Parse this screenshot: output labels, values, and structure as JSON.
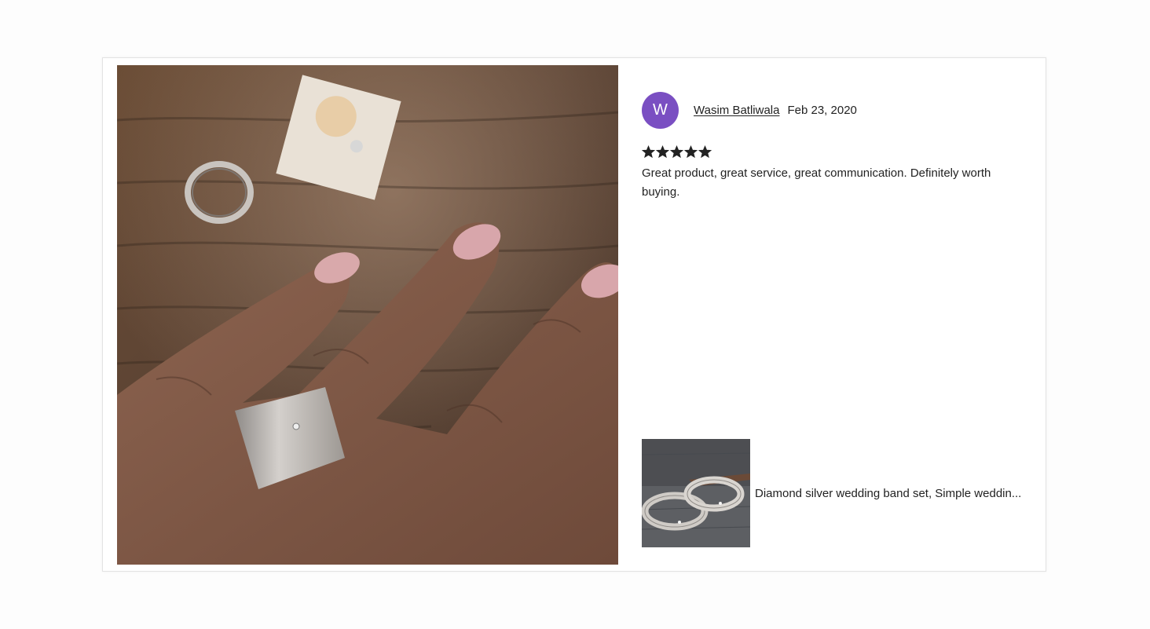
{
  "reviewer": {
    "initial": "W",
    "name": "Wasim Batliwala",
    "date": "Feb 23, 2020",
    "avatar_color": "#7a4fc2"
  },
  "rating": {
    "value": 5,
    "max": 5,
    "star_color": "#222222"
  },
  "review": {
    "text": "Great product, great service, great communication. Definitely worth buying."
  },
  "listing": {
    "title": "Diamond silver wedding band set, Simple weddin..."
  },
  "photo": {
    "icon": "review-photo-hand-with-ring"
  }
}
